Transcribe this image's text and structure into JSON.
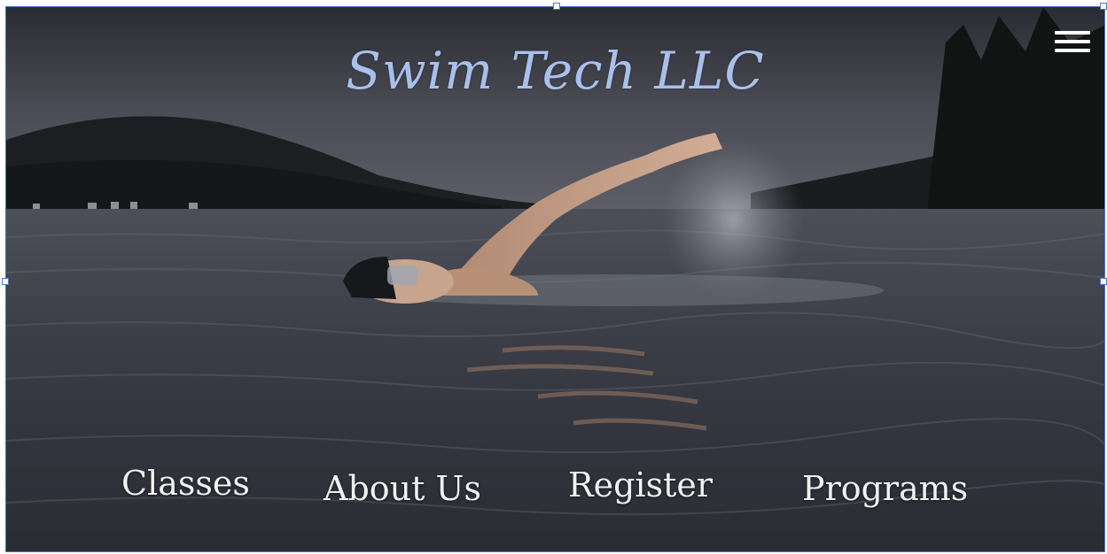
{
  "site": {
    "title": "Swim Tech LLC"
  },
  "nav": {
    "items": [
      {
        "label": "Classes"
      },
      {
        "label": "About Us"
      },
      {
        "label": "Register"
      },
      {
        "label": "Programs"
      }
    ]
  },
  "header": {
    "menu_icon": "hamburger-menu-icon"
  },
  "colors": {
    "title": "#a9c0ea",
    "nav_text": "#f2f2f2",
    "selection_border": "#4a78c8"
  }
}
